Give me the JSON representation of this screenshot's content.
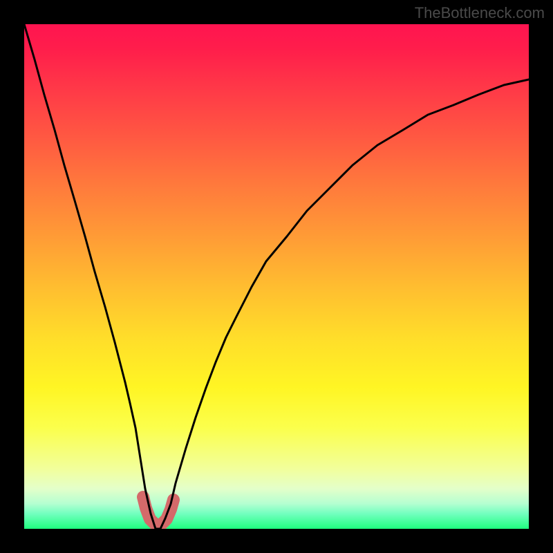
{
  "watermark": "TheBottleneck.com",
  "chart_data": {
    "type": "line",
    "title": "",
    "xlabel": "",
    "ylabel": "",
    "xlim": [
      0,
      100
    ],
    "ylim": [
      0,
      100
    ],
    "x": [
      0,
      2,
      4,
      6,
      8,
      10,
      12,
      14,
      16,
      18,
      20,
      21,
      22,
      23,
      24,
      25,
      26,
      27,
      28,
      29,
      30,
      32,
      34,
      36,
      38,
      40,
      42,
      45,
      48,
      52,
      56,
      60,
      65,
      70,
      75,
      80,
      85,
      90,
      95,
      100
    ],
    "values": [
      100,
      93,
      86,
      79,
      72,
      65,
      58,
      51,
      44,
      37,
      29,
      25,
      20,
      14,
      8,
      3,
      0,
      0,
      2,
      5,
      9,
      16,
      22,
      28,
      33,
      38,
      42,
      48,
      53,
      58,
      63,
      67,
      72,
      76,
      79,
      82,
      84,
      86,
      88,
      89
    ],
    "highlight_range_x": [
      23.5,
      29
    ],
    "series_color": "#000000",
    "highlight_color": "#d46a6a",
    "background_gradient": {
      "top": "#ff1450",
      "middle": "#ffdd2a",
      "bottom": "#1fff7f"
    }
  }
}
